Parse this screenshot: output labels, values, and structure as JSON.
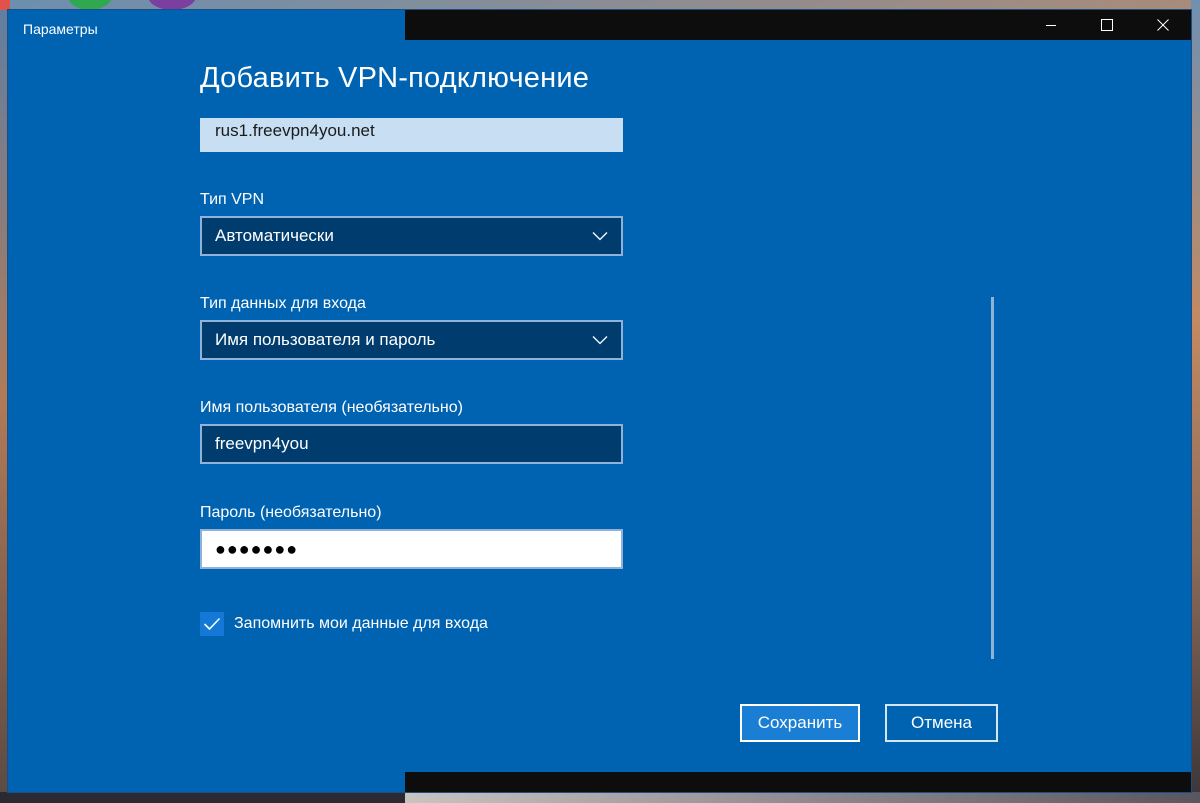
{
  "window": {
    "title": "Параметры"
  },
  "dialog": {
    "title": "Добавить VPN-подключение",
    "server_value": "rus1.freevpn4you.net",
    "vpn_type": {
      "label": "Тип VPN",
      "selected": "Автоматически"
    },
    "signin_type": {
      "label": "Тип данных для входа",
      "selected": "Имя пользователя и пароль"
    },
    "username": {
      "label": "Имя пользователя (необязательно)",
      "value": "freevpn4you"
    },
    "password": {
      "label": "Пароль (необязательно)",
      "value": "●●●●●●●"
    },
    "remember": {
      "label": "Запомнить мои данные для входа",
      "checked": true
    },
    "buttons": {
      "save": "Сохранить",
      "cancel": "Отмена"
    }
  },
  "icons": {
    "minimize": "minimize-icon",
    "maximize": "maximize-icon",
    "close": "close-icon",
    "dropdown": "chevron-down-icon",
    "check": "checkmark-icon"
  },
  "colors": {
    "window_bg": "#0063b1",
    "field_bg": "#003d6e",
    "accent": "#1a7fd4"
  }
}
